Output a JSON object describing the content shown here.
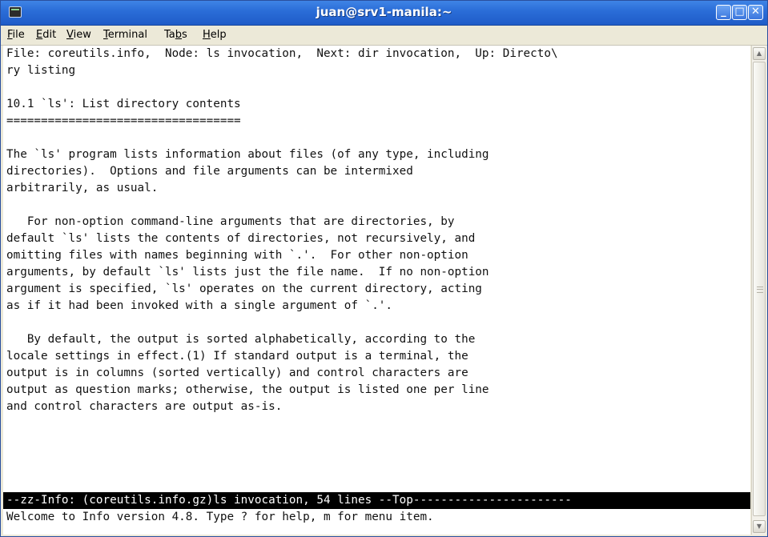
{
  "window": {
    "title": "juan@srv1-manila:~"
  },
  "menubar": {
    "items": [
      {
        "pre": "",
        "accel": "F",
        "post": "ile"
      },
      {
        "pre": "",
        "accel": "E",
        "post": "dit"
      },
      {
        "pre": "",
        "accel": "V",
        "post": "iew"
      },
      {
        "pre": "",
        "accel": "T",
        "post": "erminal"
      },
      {
        "pre": "Ta",
        "accel": "b",
        "post": "s"
      },
      {
        "pre": "",
        "accel": "H",
        "post": "elp"
      }
    ]
  },
  "terminal": {
    "lines": [
      "File: coreutils.info,  Node: ls invocation,  Next: dir invocation,  Up: Directo\\",
      "ry listing",
      "",
      "10.1 `ls': List directory contents",
      "==================================",
      "",
      "The `ls' program lists information about files (of any type, including",
      "directories).  Options and file arguments can be intermixed",
      "arbitrarily, as usual.",
      "",
      "   For non-option command-line arguments that are directories, by",
      "default `ls' lists the contents of directories, not recursively, and",
      "omitting files with names beginning with `.'.  For other non-option",
      "arguments, by default `ls' lists just the file name.  If no non-option",
      "argument is specified, `ls' operates on the current directory, acting",
      "as if it had been invoked with a single argument of `.'.",
      "",
      "   By default, the output is sorted alphabetically, according to the",
      "locale settings in effect.(1) If standard output is a terminal, the",
      "output is in columns (sorted vertically) and control characters are",
      "output as question marks; otherwise, the output is listed one per line",
      "and control characters are output as-is."
    ],
    "status_line": "--zz-Info: (coreutils.info.gz)ls invocation, 54 lines --Top-----------------------",
    "echo_line": "Welcome to Info version 4.8. Type ? for help, m for menu item."
  },
  "icons": {
    "terminal_app": "terminal-icon",
    "minimize": "minimize-icon",
    "maximize": "maximize-icon",
    "close": "close-icon",
    "scroll_up": "arrow-up-icon",
    "scroll_down": "arrow-down-icon"
  },
  "colors": {
    "titlebar": "#2b6ed8",
    "terminal_bg": "#ffffff",
    "terminal_fg": "#111111",
    "status_bg": "#000000",
    "status_fg": "#ffffff"
  }
}
